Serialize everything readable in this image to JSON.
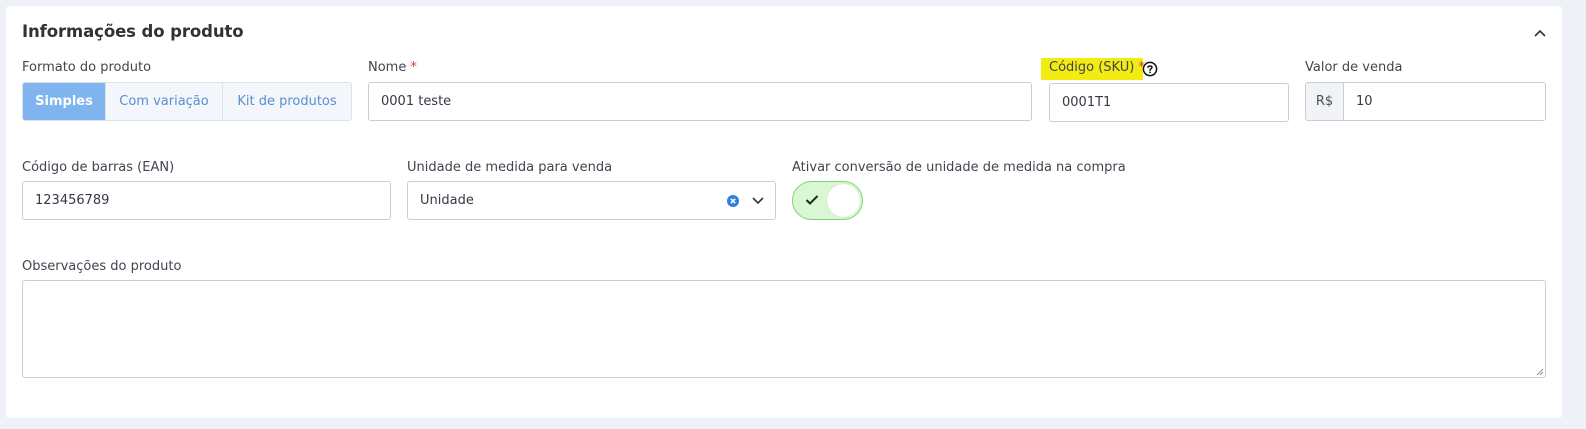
{
  "section": {
    "title": "Informações do produto"
  },
  "format": {
    "label": "Formato do produto",
    "options": [
      "Simples",
      "Com variação",
      "Kit de produtos"
    ],
    "selected": "Simples"
  },
  "name": {
    "label": "Nome",
    "required_mark": "*",
    "value": "0001 teste"
  },
  "sku": {
    "label": "Código (SKU)",
    "required_mark": "*",
    "value": "0001T1",
    "highlight_color": "#f2ec12"
  },
  "price": {
    "label": "Valor de venda",
    "currency": "R$",
    "value": "10"
  },
  "barcode": {
    "label": "Código de barras (EAN)",
    "value": "123456789"
  },
  "unit": {
    "label": "Unidade de medida para venda",
    "value": "Unidade"
  },
  "conversion": {
    "label": "Ativar conversão de unidade de medida na compra",
    "enabled": true
  },
  "notes": {
    "label": "Observações do produto",
    "value": ""
  },
  "icons": {
    "collapse": "chevron-up-icon",
    "help": "question-circle-icon",
    "clear": "clear-circle-icon",
    "dropdown": "chevron-down-icon",
    "check": "check-icon"
  },
  "colors": {
    "accent": "#7fb4ef",
    "link": "#5a8fd0",
    "toggle_on": "#d9f7d3",
    "required": "#d93838"
  }
}
